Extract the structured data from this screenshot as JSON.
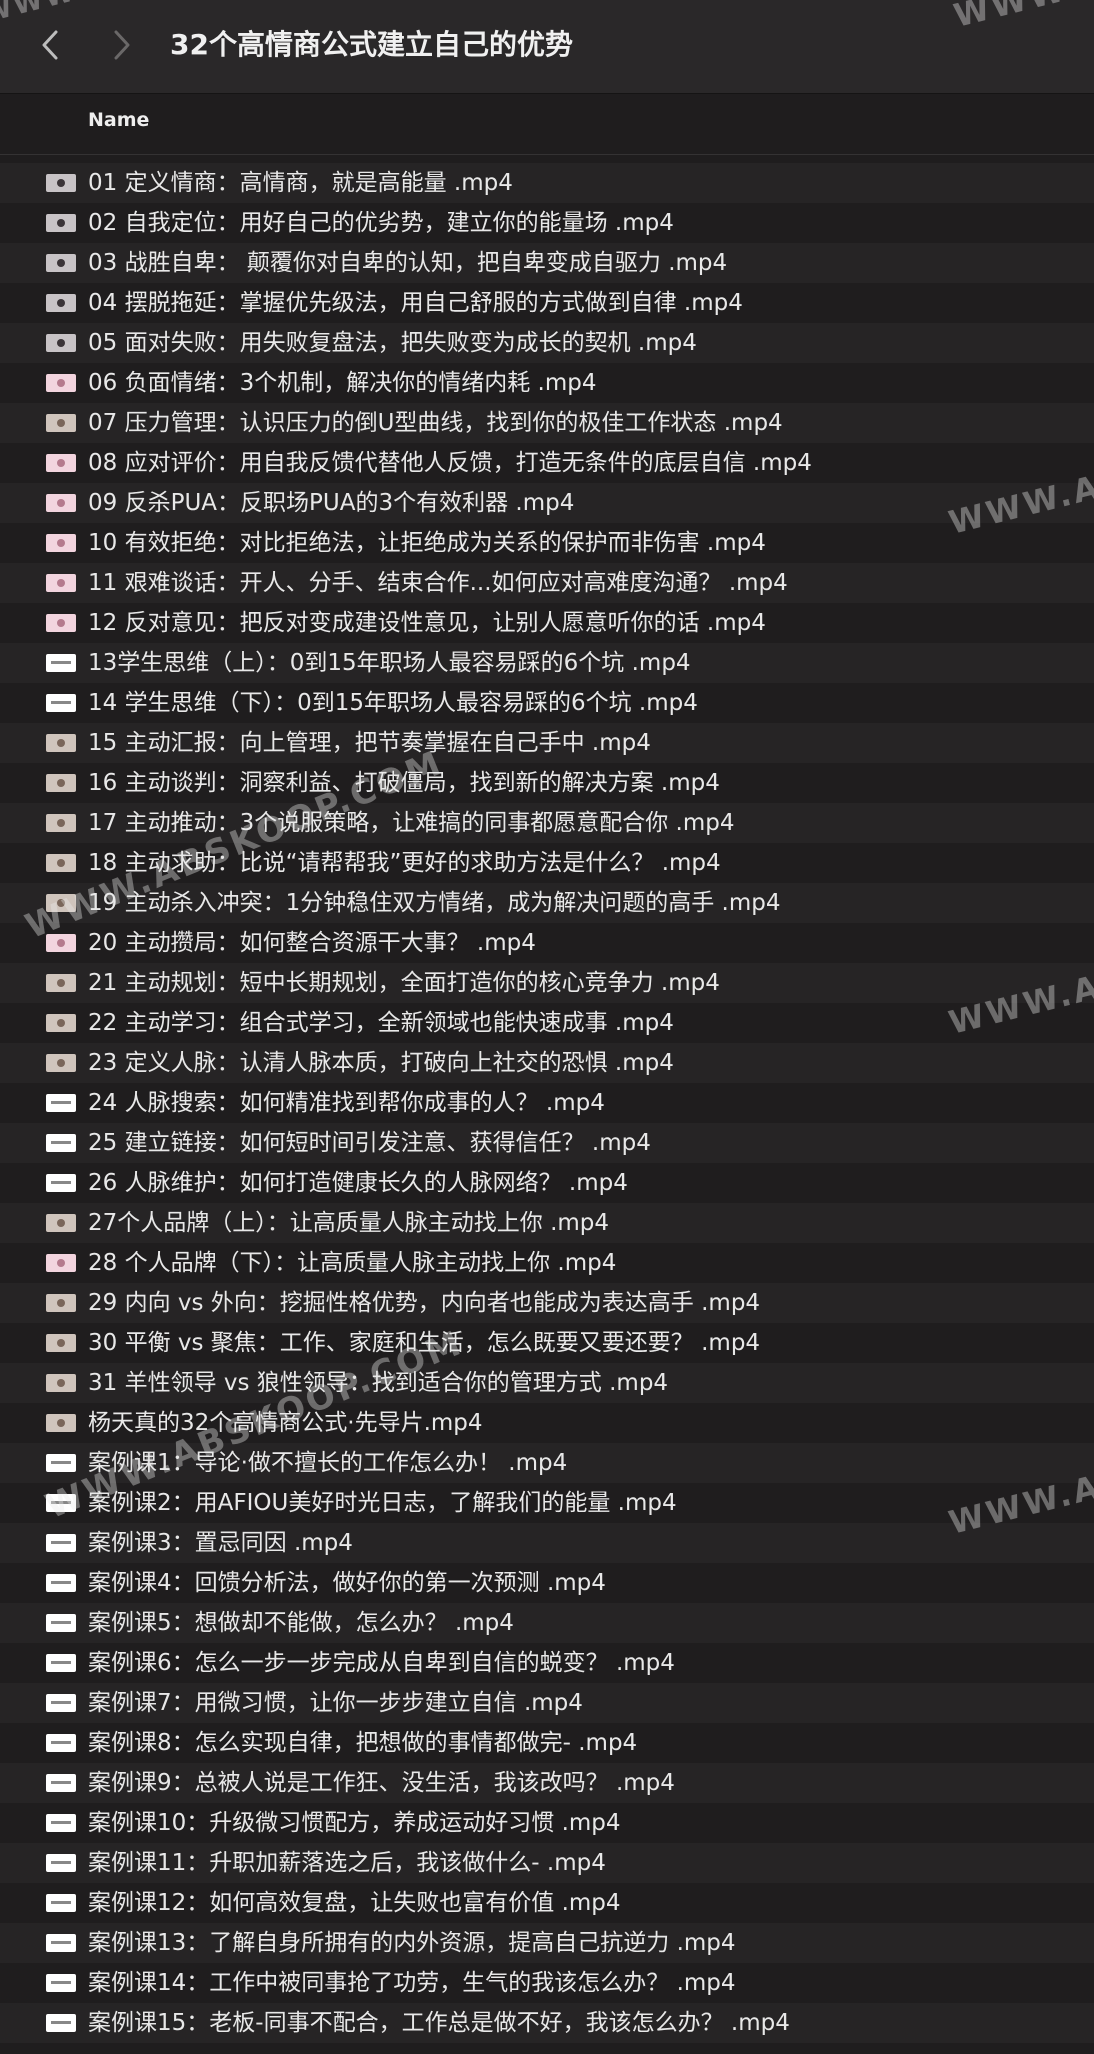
{
  "window": {
    "title": "32个高情商公式建立自己的优势",
    "back_icon": "chevron-left-icon",
    "forward_icon": "chevron-right-icon"
  },
  "header": {
    "name_column": "Name"
  },
  "files": [
    {
      "name": "01 定义情商：高情商，就是高能量 .mp4",
      "thumb": "dark"
    },
    {
      "name": "02 自我定位：用好自己的优劣势，建立你的能量场 .mp4",
      "thumb": "dark"
    },
    {
      "name": "03 战胜自卑： 颠覆你对自卑的认知，把自卑变成自驱力 .mp4",
      "thumb": "dark"
    },
    {
      "name": "04 摆脱拖延：掌握优先级法，用自己舒服的方式做到自律 .mp4",
      "thumb": "dark"
    },
    {
      "name": "05 面对失败：用失败复盘法，把失败变为成长的契机 .mp4",
      "thumb": "dark"
    },
    {
      "name": "06 负面情绪：3个机制，解决你的情绪内耗 .mp4",
      "thumb": "pink"
    },
    {
      "name": "07 压力管理：认识压力的倒U型曲线，找到你的极佳工作状态 .mp4",
      "thumb": "photo"
    },
    {
      "name": "08 应对评价：用自我反馈代替他人反馈，打造无条件的底层自信 .mp4",
      "thumb": "pink"
    },
    {
      "name": "09 反杀PUA：反职场PUA的3个有效利器 .mp4",
      "thumb": "pink"
    },
    {
      "name": "10 有效拒绝：对比拒绝法，让拒绝成为关系的保护而非伤害 .mp4",
      "thumb": "pink"
    },
    {
      "name": "11 艰难谈话：开人、分手、结束合作...如何应对高难度沟通？ .mp4",
      "thumb": "pink"
    },
    {
      "name": "12 反对意见：把反对变成建设性意见，让别人愿意听你的话 .mp4",
      "thumb": "pink"
    },
    {
      "name": "13学生思维（上）：0到15年职场人最容易踩的6个坑 .mp4",
      "thumb": "slide"
    },
    {
      "name": "14 学生思维（下）：0到15年职场人最容易踩的6个坑 .mp4",
      "thumb": "slide"
    },
    {
      "name": "15 主动汇报：向上管理，把节奏掌握在自己手中 .mp4",
      "thumb": "photo"
    },
    {
      "name": "16 主动谈判：洞察利益、打破僵局，找到新的解决方案 .mp4",
      "thumb": "photo"
    },
    {
      "name": "17 主动推动：3个说服策略，让难搞的同事都愿意配合你 .mp4",
      "thumb": "photo"
    },
    {
      "name": "18 主动求助：比说“请帮帮我”更好的求助方法是什么？ .mp4",
      "thumb": "photo"
    },
    {
      "name": "19 主动杀入冲突：1分钟稳住双方情绪，成为解决问题的高手 .mp4",
      "thumb": "photo"
    },
    {
      "name": "20 主动攒局：如何整合资源干大事？ .mp4",
      "thumb": "pink"
    },
    {
      "name": "21 主动规划：短中长期规划，全面打造你的核心竞争力 .mp4",
      "thumb": "photo"
    },
    {
      "name": "22 主动学习：组合式学习，全新领域也能快速成事 .mp4",
      "thumb": "photo"
    },
    {
      "name": "23 定义人脉：认清人脉本质，打破向上社交的恐惧 .mp4",
      "thumb": "photo"
    },
    {
      "name": "24 人脉搜索：如何精准找到帮你成事的人？ .mp4",
      "thumb": "slide"
    },
    {
      "name": "25 建立链接：如何短时间引发注意、获得信任？ .mp4",
      "thumb": "slide"
    },
    {
      "name": "26 人脉维护：如何打造健康长久的人脉网络？ .mp4",
      "thumb": "slide"
    },
    {
      "name": "27个人品牌（上）：让高质量人脉主动找上你 .mp4",
      "thumb": "photo"
    },
    {
      "name": "28 个人品牌（下）：让高质量人脉主动找上你 .mp4",
      "thumb": "pink"
    },
    {
      "name": "29 内向 vs 外向：挖掘性格优势，内向者也能成为表达高手 .mp4",
      "thumb": "photo"
    },
    {
      "name": "30 平衡 vs 聚焦：工作、家庭和生活，怎么既要又要还要？ .mp4",
      "thumb": "photo"
    },
    {
      "name": "31 羊性领导 vs 狼性领导：找到适合你的管理方式 .mp4",
      "thumb": "photo"
    },
    {
      "name": "杨天真的32个高情商公式·先导片.mp4",
      "thumb": "photo"
    },
    {
      "name": "案例课1：导论·做不擅长的工作怎么办！ .mp4",
      "thumb": "slide"
    },
    {
      "name": "案例课2：用AFIOU美好时光日志，了解我们的能量 .mp4",
      "thumb": "slide"
    },
    {
      "name": "案例课3：置忌同因 .mp4",
      "thumb": "slide"
    },
    {
      "name": "案例课4：回馈分析法，做好你的第一次预测 .mp4",
      "thumb": "slide"
    },
    {
      "name": "案例课5：想做却不能做，怎么办？ .mp4",
      "thumb": "slide"
    },
    {
      "name": "案例课6：怎么一步一步完成从自卑到自信的蜕变？ .mp4",
      "thumb": "slide"
    },
    {
      "name": "案例课7：用微习惯，让你一步步建立自信 .mp4",
      "thumb": "slide"
    },
    {
      "name": "案例课8：怎么实现自律，把想做的事情都做完- .mp4",
      "thumb": "slide"
    },
    {
      "name": "案例课9：总被人说是工作狂、没生活，我该改吗？ .mp4",
      "thumb": "slide"
    },
    {
      "name": "案例课10：升级微习惯配方，养成运动好习惯 .mp4",
      "thumb": "slide"
    },
    {
      "name": "案例课11：升职加薪落选之后，我该做什么- .mp4",
      "thumb": "slide"
    },
    {
      "name": "案例课12：如何高效复盘，让失败也富有价值 .mp4",
      "thumb": "slide"
    },
    {
      "name": "案例课13：了解自身所拥有的内外资源，提高自己抗逆力 .mp4",
      "thumb": "slide"
    },
    {
      "name": "案例课14：工作中被同事抢了功劳，生气的我该怎么办？ .mp4",
      "thumb": "slide"
    },
    {
      "name": "案例课15：老板-同事不配合，工作总是做不好，我该怎么办？ .mp4",
      "thumb": "slide"
    }
  ],
  "watermarks": [
    {
      "text": "WWW.A"
    },
    {
      "text": "WWW.ABSKOOP.COM"
    },
    {
      "text": "WWW.ABSKOOP.COM"
    },
    {
      "text": "WWW.A"
    },
    {
      "text": "WWW.A"
    },
    {
      "text": "WWW.A"
    },
    {
      "text": "WWW.ABSKOOP.COM"
    },
    {
      "text": "WWW.A"
    }
  ]
}
